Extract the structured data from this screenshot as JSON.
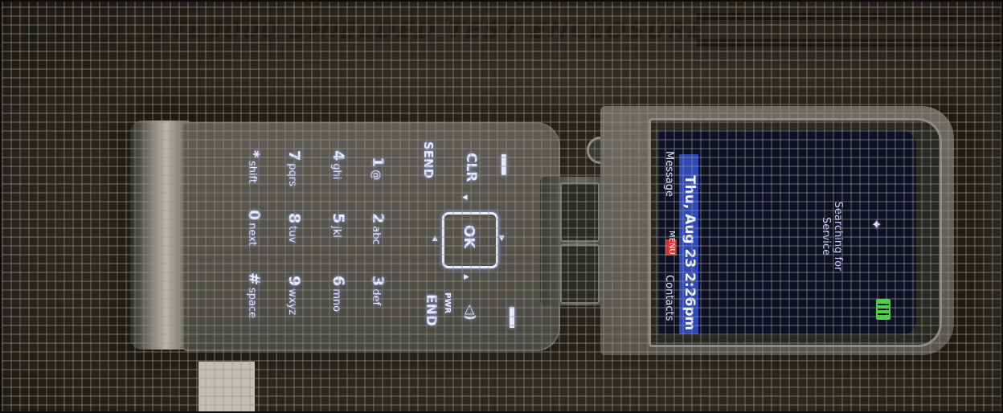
{
  "enclosure": {
    "brand": "ramsey",
    "label": "STE3000 SHIELDED TEST ENCLOSURE"
  },
  "keypad": {
    "keys": [
      {
        "digit": "1",
        "letters": "@"
      },
      {
        "digit": "2",
        "letters": "abc"
      },
      {
        "digit": "3",
        "letters": "def"
      },
      {
        "digit": "4",
        "letters": "ghi"
      },
      {
        "digit": "5",
        "letters": "jkl"
      },
      {
        "digit": "6",
        "letters": "mno"
      },
      {
        "digit": "7",
        "letters": "pqrs"
      },
      {
        "digit": "8",
        "letters": "tuv"
      },
      {
        "digit": "9",
        "letters": "wxyz"
      },
      {
        "digit": "*",
        "letters": "shift"
      },
      {
        "digit": "0",
        "letters": "next"
      },
      {
        "digit": "#",
        "letters": "space"
      }
    ],
    "send_label": "SEND",
    "clr_label": "CLR",
    "end_label": "END",
    "end_sub": "PWR",
    "ok_label": "OK",
    "speaker_symbol": "◁)"
  },
  "display": {
    "datetime": "Thu, Aug 23 2:26pm",
    "left_soft_key": "Message",
    "right_soft_key": "Contacts",
    "center_label": "MENU",
    "carrier_line1": "Searching for",
    "carrier_line2": "Service"
  },
  "colors": {
    "status_bar": "#2e48b8",
    "battery": "#3cdc3c",
    "key_glow": "#e8ecff"
  }
}
